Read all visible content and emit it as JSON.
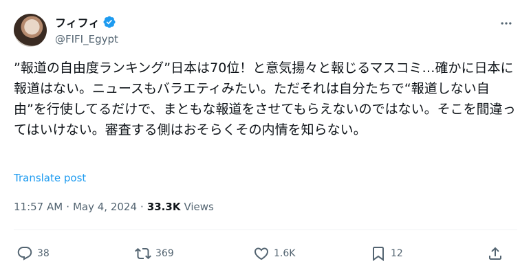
{
  "author": {
    "display_name": "フィフィ",
    "handle": "@FIFI_Egypt",
    "verified_icon": "verified-badge-icon"
  },
  "post": {
    "text": "”報道の自由度ランキング”日本は70位！と意気揚々と報じるマスコミ…確かに日本に報道はない。ニュースもバラエティみたい。ただそれは自分たちで“報道しない自由”を行使してるだけで、まともな報道をさせてもらえないのではない。そこを間違ってはいけない。審査する側はおそらくその内情を知らない。",
    "translate_label": "Translate post"
  },
  "meta": {
    "time": "11:57 AM",
    "separator1": "·",
    "date": "May 4, 2024",
    "separator2": "·",
    "views_count": "33.3K",
    "views_label": "Views"
  },
  "actions": {
    "reply_count": "38",
    "retweet_count": "369",
    "like_count": "1.6K",
    "bookmark_count": "12"
  },
  "colors": {
    "accent": "#1d9bf0",
    "secondary_text": "#536471",
    "primary_text": "#0f1419"
  }
}
